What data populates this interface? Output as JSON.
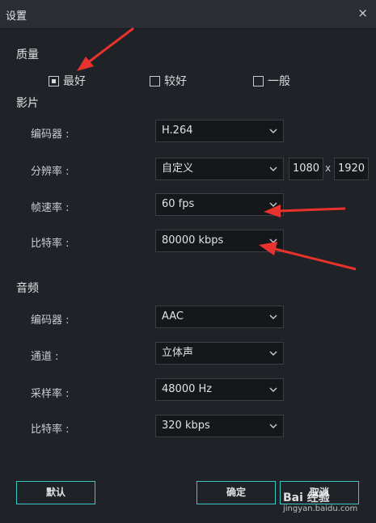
{
  "window": {
    "title": "设置",
    "close_symbol": "×"
  },
  "quality": {
    "heading": "质量",
    "options": [
      {
        "label": "最好",
        "checked": true
      },
      {
        "label": "较好",
        "checked": false
      },
      {
        "label": "一般",
        "checked": false
      }
    ]
  },
  "video": {
    "heading": "影片",
    "encoder": {
      "label": "编码器 :",
      "value": "H.264"
    },
    "resolution": {
      "label": "分辨率 :",
      "value": "自定义",
      "width": "1080",
      "separator": "x",
      "height": "1920"
    },
    "framerate": {
      "label": "帧速率 :",
      "value": "60 fps"
    },
    "bitrate": {
      "label": "比特率 :",
      "value": "80000 kbps"
    }
  },
  "audio": {
    "heading": "音频",
    "encoder": {
      "label": "编码器 :",
      "value": "AAC"
    },
    "channel": {
      "label": "通道 :",
      "value": "立体声"
    },
    "samplerate": {
      "label": "采样率 :",
      "value": "48000 Hz"
    },
    "bitrate": {
      "label": "比特率 :",
      "value": "320 kbps"
    }
  },
  "buttons": {
    "default": "默认",
    "ok": "确定",
    "cancel": "取消"
  },
  "watermark": {
    "brand": "Bai 经验",
    "url": "jingyan.baidu.com"
  },
  "colors": {
    "accent": "#3cc7c2",
    "annotation_arrow": "#e8322d"
  }
}
